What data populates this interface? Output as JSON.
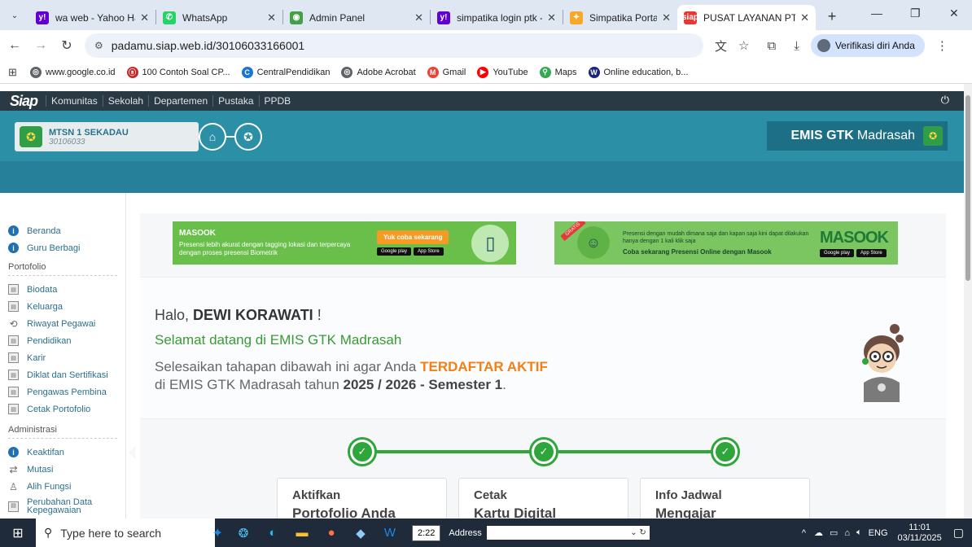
{
  "browser": {
    "tabs": [
      {
        "title": "wa web - Yahoo Hasil",
        "fav": "y!",
        "color": "#6001d2",
        "active": false
      },
      {
        "title": "WhatsApp",
        "fav": "✆",
        "color": "#25d366",
        "active": false
      },
      {
        "title": "Admin Panel",
        "fav": "◉",
        "color": "#43a047",
        "active": false
      },
      {
        "title": "simpatika login ptk -",
        "fav": "y!",
        "color": "#6001d2",
        "active": false
      },
      {
        "title": "Simpatika Portal",
        "fav": "✦",
        "color": "#f9a825",
        "active": false
      },
      {
        "title": "PUSAT LAYANAN PTK",
        "fav": "siap",
        "color": "#e53935",
        "active": true
      }
    ],
    "url": "padamu.siap.web.id/30106033166001",
    "verify_label": "Verifikasi diri Anda",
    "bookmarks": [
      {
        "label": "www.google.co.id",
        "color": "#5f6368",
        "glyph": "◎"
      },
      {
        "label": "100 Contoh Soal CP...",
        "color": "#c62828",
        "glyph": "ⓐ"
      },
      {
        "label": "CentralPendidikan",
        "color": "#1976d2",
        "glyph": "C"
      },
      {
        "label": "Adobe Acrobat",
        "color": "#5f6368",
        "glyph": "◎"
      },
      {
        "label": "Gmail",
        "color": "#ea4335",
        "glyph": "M"
      },
      {
        "label": "YouTube",
        "color": "#ff0000",
        "glyph": "▶"
      },
      {
        "label": "Maps",
        "color": "#34a853",
        "glyph": "⚲"
      },
      {
        "label": "Online education, b...",
        "color": "#1a237e",
        "glyph": "W"
      }
    ]
  },
  "siap": {
    "logo": "Siap",
    "nav": [
      "Komunitas",
      "Sekolah",
      "Departemen",
      "Pustaka",
      "PPDB"
    ],
    "school_name": "MTSN 1 SEKADAU",
    "school_code": "30106033",
    "badge_bold": "EMIS GTK",
    "badge_rest": "Madrasah"
  },
  "sidebar": {
    "top": [
      {
        "label": "Beranda",
        "icon": "info-icon"
      },
      {
        "label": "Guru Berbagi",
        "icon": "info-icon"
      }
    ],
    "portfolio_heading": "Portofolio",
    "portfolio": [
      {
        "label": "Biodata",
        "icon": "document-icon"
      },
      {
        "label": "Keluarga",
        "icon": "document-icon"
      },
      {
        "label": "Riwayat Pegawai",
        "icon": "history-icon"
      },
      {
        "label": "Pendidikan",
        "icon": "document-icon"
      },
      {
        "label": "Karir",
        "icon": "document-icon"
      },
      {
        "label": "Diklat dan Sertifikasi",
        "icon": "document-icon"
      },
      {
        "label": "Pengawas Pembina",
        "icon": "document-icon"
      },
      {
        "label": "Cetak Portofolio",
        "icon": "document-icon"
      }
    ],
    "admin_heading": "Administrasi",
    "admin": [
      {
        "label": "Keaktifan",
        "icon": "info-icon"
      },
      {
        "label": "Mutasi",
        "icon": "transfer-icon"
      },
      {
        "label": "Alih Fungsi",
        "icon": "person-icon"
      },
      {
        "label": "Perubahan Data Kepegawaian",
        "icon": "document-icon"
      }
    ]
  },
  "banners": {
    "left_title": "MASOOK",
    "left_text": "Presensi lebih akurat dengan tagging lokasi dan terpercaya dengan proses presensi Biometrik",
    "left_button": "Yuk coba sekarang",
    "right_text": "Presensi dengan mudah dimana saja dan kapan saja kini dapat dilakukan hanya dengan 1 kali klik saja",
    "right_cta": "Coba sekarang Presensi Online dengan Masook",
    "right_brand": "MASOOK",
    "store1": "Google play",
    "store2": "App Store",
    "ribbon": "GRATIS"
  },
  "welcome": {
    "hello_prefix": "Halo, ",
    "user_name": "DEWI KORAWATI",
    "hello_suffix": " !",
    "greeting": "Selamat datang di EMIS GTK Madrasah",
    "instr_1": "Selesaikan tahapan dibawah ini agar Anda ",
    "instr_highlight": "TERDAFTAR AKTIF",
    "instr_2": "di EMIS GTK Madrasah tahun ",
    "instr_year": "2025 / 2026 - Semester 1",
    "instr_end": "."
  },
  "steps": [
    {
      "line1": "Aktifkan",
      "line2": "Portofolio Anda"
    },
    {
      "line1": "Cetak",
      "line2": "Kartu Digital"
    },
    {
      "line1": "Info Jadwal",
      "line2": "Mengajar"
    }
  ],
  "taskbar": {
    "search_placeholder": "Type here to search",
    "clock_widget": "2:22",
    "address_label": "Address",
    "lang": "ENG",
    "time": "11:01",
    "date": "03/11/2025"
  }
}
